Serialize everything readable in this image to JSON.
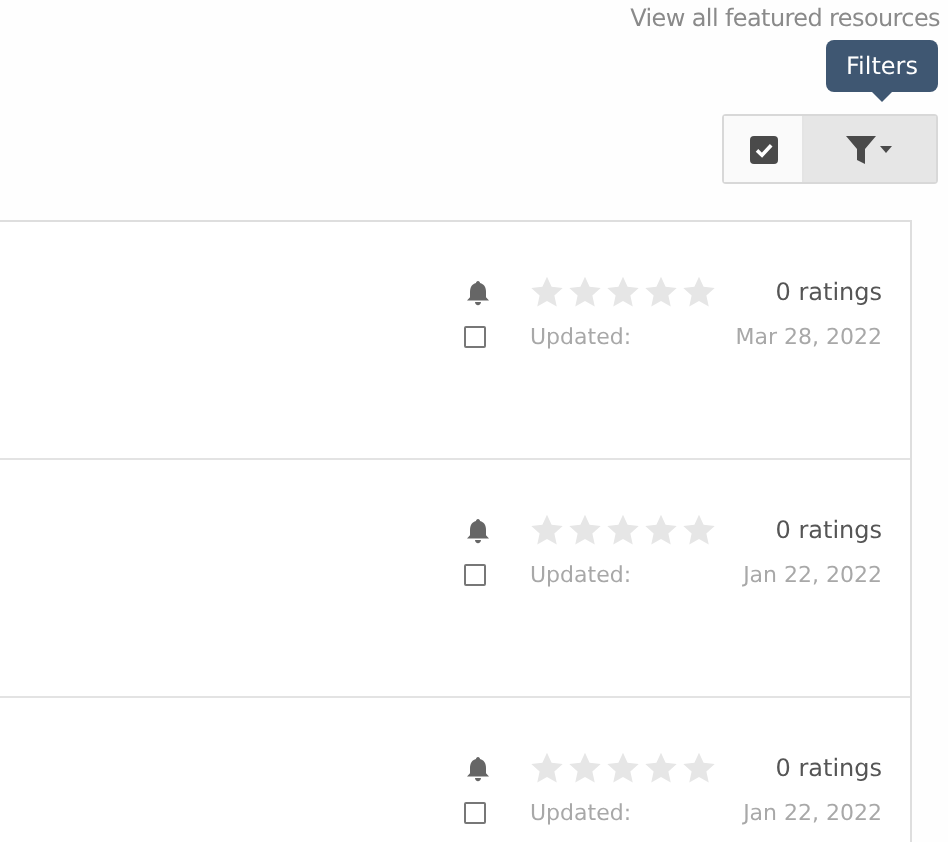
{
  "header": {
    "link": "View all featured resources"
  },
  "toolbar": {
    "tooltip": "Filters",
    "buttons": [
      {
        "kind": "select",
        "active": false
      },
      {
        "kind": "filter",
        "active": true
      }
    ]
  },
  "resources": [
    {
      "stars": 0,
      "ratings": "0 ratings",
      "updated_label": "Updated:",
      "date": "Mar 28, 2022",
      "checked": false
    },
    {
      "stars": 0,
      "ratings": "0 ratings",
      "updated_label": "Updated:",
      "date": "Jan 22, 2022",
      "checked": false
    },
    {
      "stars": 0,
      "ratings": "0 ratings",
      "updated_label": "Updated:",
      "date": "Jan 22, 2022",
      "checked": false
    }
  ]
}
